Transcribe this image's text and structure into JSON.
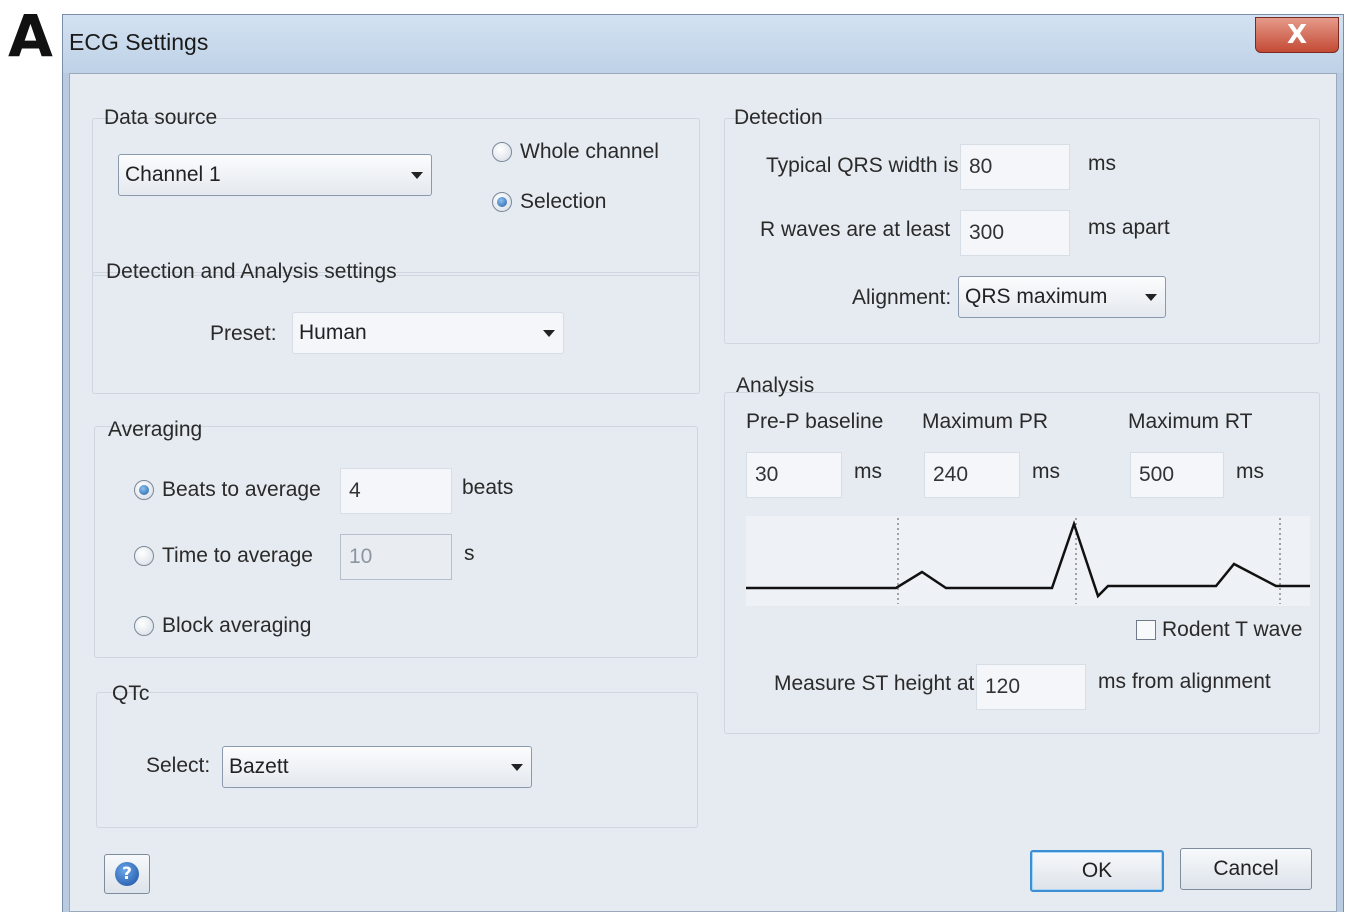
{
  "figure_letter": "A",
  "window": {
    "title": "ECG Settings",
    "close_label": "X"
  },
  "data_source": {
    "group_label": "Data source",
    "channel_value": "Channel 1",
    "whole_channel_label": "Whole channel",
    "selection_label": "Selection",
    "selected": "Selection"
  },
  "detection_analysis": {
    "group_label": "Detection and Analysis settings",
    "preset_label": "Preset:",
    "preset_value": "Human"
  },
  "averaging": {
    "group_label": "Averaging",
    "beats_label": "Beats to average",
    "beats_value": "4",
    "beats_unit": "beats",
    "time_label": "Time to average",
    "time_value": "10",
    "time_unit": "s",
    "block_label": "Block averaging",
    "selected": "Beats to average"
  },
  "qtc": {
    "group_label": "QTc",
    "select_label": "Select:",
    "select_value": "Bazett"
  },
  "detection": {
    "group_label": "Detection",
    "qrs_label": "Typical QRS width is",
    "qrs_value": "80",
    "qrs_unit": "ms",
    "rwave_label": "R waves are at least",
    "rwave_value": "300",
    "rwave_unit": "ms apart",
    "alignment_label": "Alignment:",
    "alignment_value": "QRS maximum"
  },
  "analysis": {
    "group_label": "Analysis",
    "prep_label": "Pre-P baseline",
    "prep_value": "30",
    "prep_unit": "ms",
    "maxpr_label": "Maximum PR",
    "maxpr_value": "240",
    "maxpr_unit": "ms",
    "maxrt_label": "Maximum RT",
    "maxrt_value": "500",
    "maxrt_unit": "ms",
    "rodent_label": "Rodent T wave",
    "rodent_checked": false,
    "st_label": "Measure ST height at",
    "st_value": "120",
    "st_unit": "ms from alignment"
  },
  "buttons": {
    "ok": "OK",
    "cancel": "Cancel",
    "help_icon": "?"
  },
  "colors": {
    "title_bar": "#c4d6ea",
    "close": "#c9503b",
    "dialog": "#e6ebf1",
    "default_button_border": "#3c8fd2"
  }
}
